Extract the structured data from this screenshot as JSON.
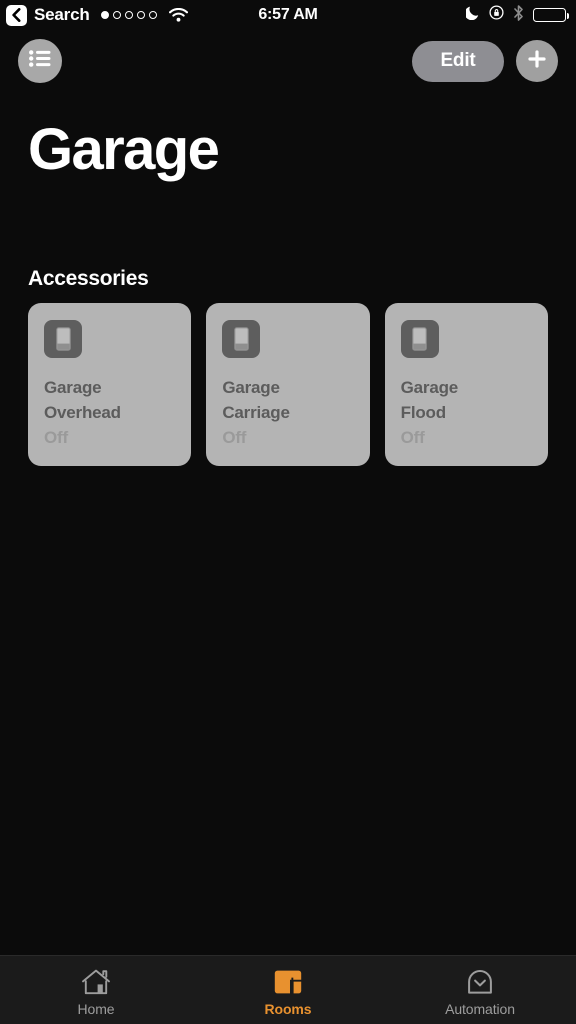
{
  "status_bar": {
    "back_label": "Search",
    "back_icon": "chevron-left-icon",
    "signal_dots_total": 5,
    "signal_dots_filled": 1,
    "wifi_icon": "wifi-icon",
    "time": "6:57 AM",
    "right_icons": [
      {
        "name": "moon-icon",
        "label": "Do Not Disturb"
      },
      {
        "name": "rotation-lock-icon",
        "label": "Rotation Lock"
      },
      {
        "name": "bluetooth-icon",
        "label": "Bluetooth"
      },
      {
        "name": "battery-icon",
        "label": "Battery"
      }
    ]
  },
  "nav_bar": {
    "menu_icon": "list-icon",
    "edit_label": "Edit",
    "add_icon": "plus-icon"
  },
  "page_title": "Garage",
  "sections": {
    "accessories": {
      "header": "Accessories",
      "items": [
        {
          "name": "Garage\nOverhead",
          "name_line1": "Garage",
          "name_line2": "Overhead",
          "state": "Off",
          "icon": "light-switch-icon"
        },
        {
          "name": "Garage\nCarriage",
          "name_line1": "Garage",
          "name_line2": "Carriage",
          "state": "Off",
          "icon": "light-switch-icon"
        },
        {
          "name": "Garage\nFlood",
          "name_line1": "Garage",
          "name_line2": "Flood",
          "state": "Off",
          "icon": "light-switch-icon"
        }
      ]
    }
  },
  "tab_bar": {
    "active_tab": "Rooms",
    "tabs": [
      {
        "label": "Home",
        "icon": "house-icon",
        "active": false
      },
      {
        "label": "Rooms",
        "icon": "rooms-icon",
        "active": true
      },
      {
        "label": "Automation",
        "icon": "automation-clock-icon",
        "active": false
      }
    ]
  },
  "colors": {
    "background": "#0b0b0b",
    "card": "#b4b4b4",
    "card_icon": "#5e5e5e",
    "accent": "#e8912f",
    "nav_control": "#8e8e93",
    "tab_inactive": "#9d9d9d"
  }
}
